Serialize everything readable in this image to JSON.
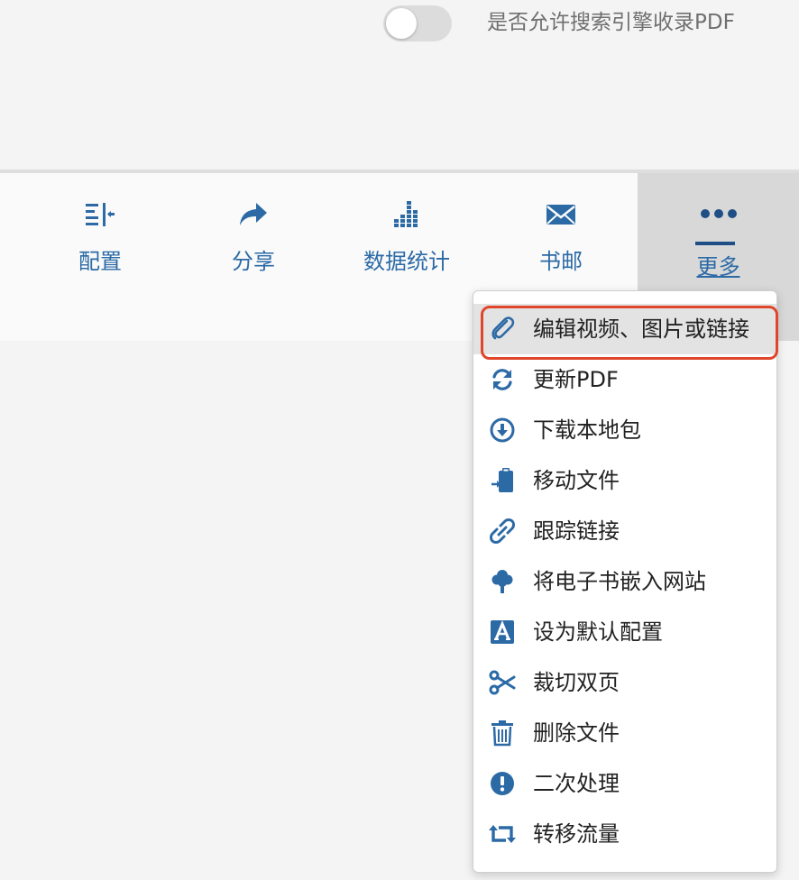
{
  "settings": {
    "search_index_label": "是否允许搜索引擎收录PDF",
    "search_index_enabled": false
  },
  "toolbar": {
    "items": [
      {
        "label": "配置",
        "icon": "configure-icon"
      },
      {
        "label": "分享",
        "icon": "share-icon"
      },
      {
        "label": "数据统计",
        "icon": "statistics-icon"
      },
      {
        "label": "书邮",
        "icon": "mail-icon"
      }
    ],
    "more": {
      "label": "更多",
      "icon": "more-dots-icon"
    }
  },
  "menu": {
    "items": [
      {
        "label": "编辑视频、图片或链接",
        "icon": "paperclip-icon"
      },
      {
        "label": "更新PDF",
        "icon": "refresh-icon"
      },
      {
        "label": "下载本地包",
        "icon": "download-icon"
      },
      {
        "label": "移动文件",
        "icon": "move-file-icon"
      },
      {
        "label": "跟踪链接",
        "icon": "link-icon"
      },
      {
        "label": "将电子书嵌入网站",
        "icon": "tree-icon"
      },
      {
        "label": "设为默认配置",
        "icon": "font-a-icon"
      },
      {
        "label": "裁切双页",
        "icon": "scissors-icon"
      },
      {
        "label": "删除文件",
        "icon": "trash-icon"
      },
      {
        "label": "二次处理",
        "icon": "exclamation-icon"
      },
      {
        "label": "转移流量",
        "icon": "retweet-icon"
      }
    ],
    "highlighted_index": 0
  },
  "colors": {
    "accent": "#2c6aa6",
    "highlight_border": "#e0462b",
    "toggle_off": "#dcdcdc"
  }
}
